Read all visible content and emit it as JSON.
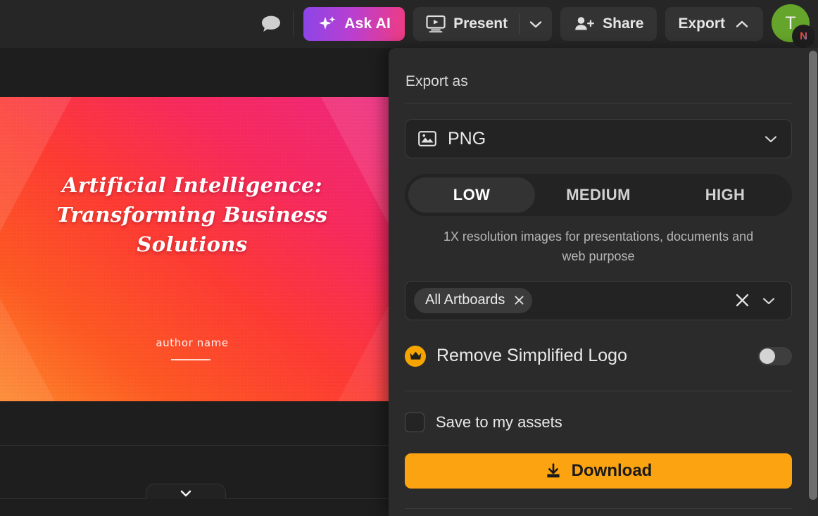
{
  "topbar": {
    "comment_icon": "speech-bubble-icon",
    "ask_ai_label": "Ask AI",
    "ask_ai_icon": "sparkles-icon",
    "present_label": "Present",
    "present_icon": "present-screen-icon",
    "present_caret_icon": "chevron-down-icon",
    "share_label": "Share",
    "share_icon": "person-add-icon",
    "export_label": "Export",
    "export_caret_icon": "chevron-up-icon",
    "avatar_initial": "T",
    "avatar_badge": "N"
  },
  "canvas": {
    "slide": {
      "title": "Artificial Intelligence: Transforming Business Solutions",
      "author": "author name"
    },
    "collapse_tab_icon": "chevron-down-icon"
  },
  "export_panel": {
    "heading": "Export as",
    "format": {
      "value": "PNG",
      "icon": "image-icon",
      "caret_icon": "chevron-down-icon"
    },
    "quality": {
      "options": [
        "LOW",
        "MEDIUM",
        "HIGH"
      ],
      "selected": "LOW",
      "description": "1X resolution images for presentations, documents and web purpose"
    },
    "artboards": {
      "tags": [
        "All Artboards"
      ],
      "tag_remove_icon": "close-icon",
      "clear_icon": "close-icon",
      "caret_icon": "chevron-down-icon"
    },
    "premium": {
      "icon": "crown-icon",
      "label": "Remove Simplified Logo",
      "toggle_on": false
    },
    "save_assets": {
      "label": "Save to my assets",
      "checked": false
    },
    "download": {
      "label": "Download",
      "icon": "download-icon"
    }
  },
  "colors": {
    "accent_amber": "#fca311",
    "ask_ai_gradient_start": "#8b45e8",
    "ask_ai_gradient_end": "#ef3b82",
    "avatar_green": "#66a52b",
    "panel_bg": "#2b2b2b",
    "canvas_bg": "#1e1e1e"
  }
}
